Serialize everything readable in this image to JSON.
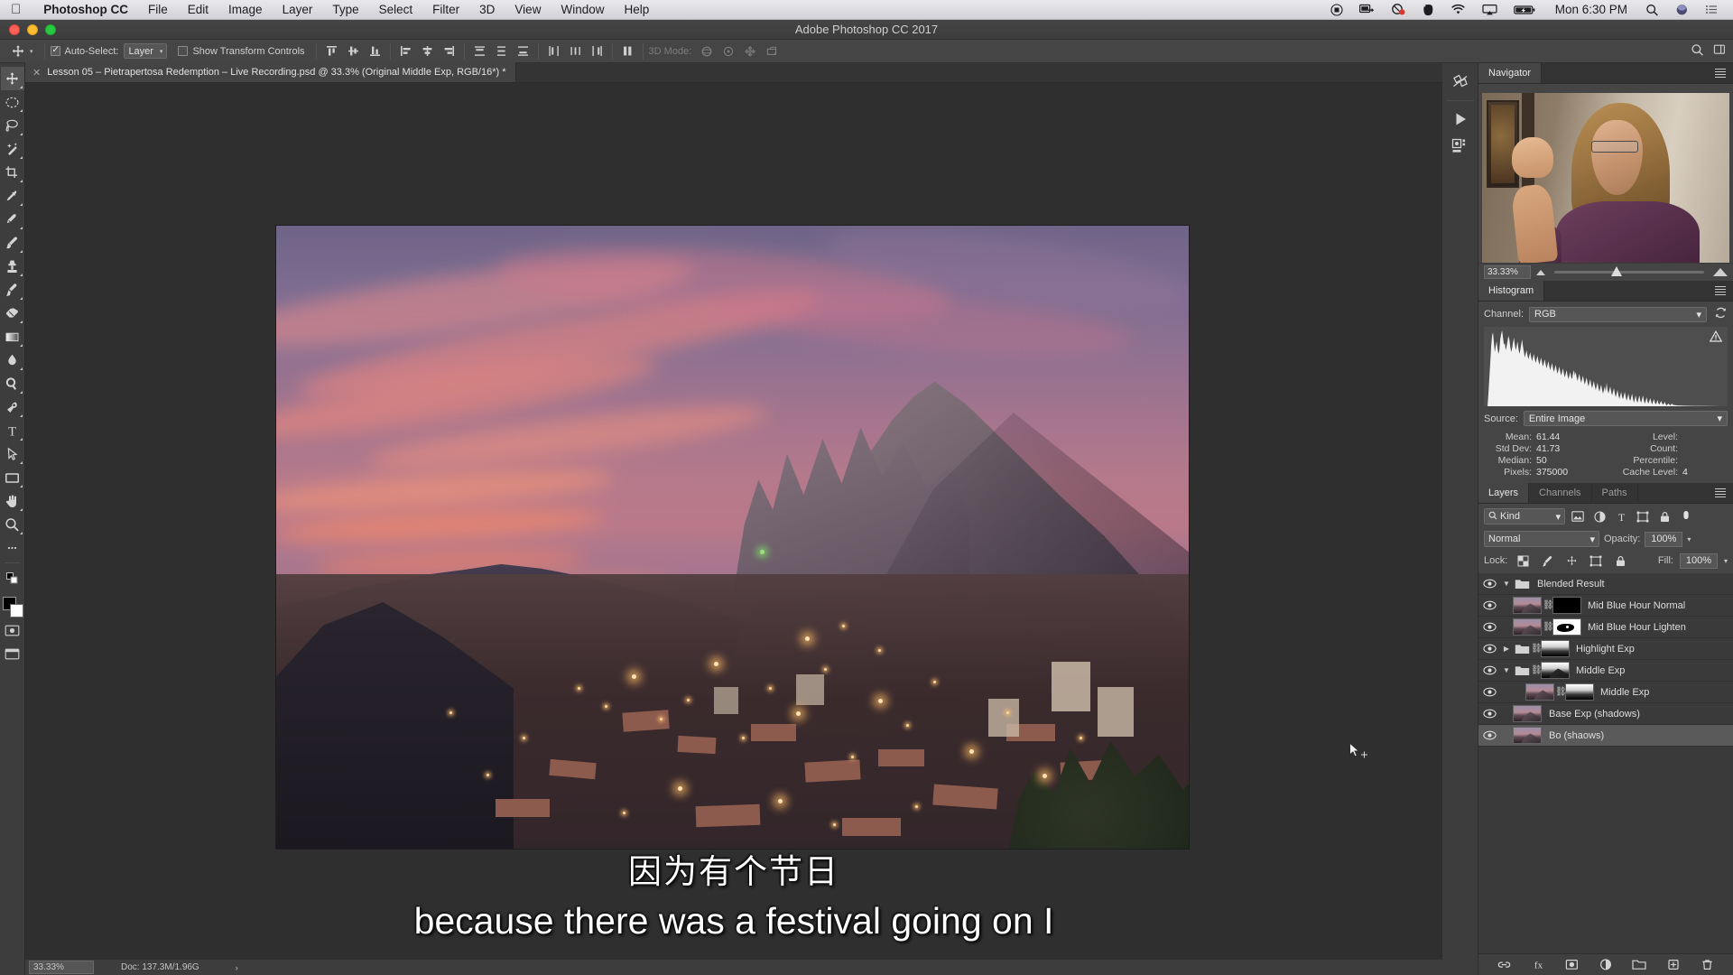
{
  "macbar": {
    "apple_icon": "apple-logo-icon",
    "app_name": "Photoshop CC",
    "menus": [
      "File",
      "Edit",
      "Image",
      "Layer",
      "Type",
      "Select",
      "Filter",
      "3D",
      "View",
      "Window",
      "Help"
    ],
    "status_icons": [
      "record-icon",
      "screen-share-icon",
      "do-not-disturb-icon",
      "evernote-icon",
      "wifi-icon",
      "airplay-icon",
      "battery-charging-icon"
    ],
    "clock": "Mon 6:30 PM",
    "search_icon": "search-icon",
    "siri_icon": "siri-icon",
    "notification_icon": "notification-center-icon"
  },
  "titlebar": {
    "app_title": "Adobe Photoshop CC 2017"
  },
  "options_bar": {
    "tool_icon": "move-tool-icon",
    "auto_select_label": "Auto-Select:",
    "auto_select_checked": true,
    "auto_select_value": "Layer",
    "show_transform_label": "Show Transform Controls",
    "show_transform_checked": false,
    "align_icons": [
      "align-top-edges-icon",
      "align-vertical-centers-icon",
      "align-bottom-edges-icon",
      "align-left-edges-icon",
      "align-horizontal-centers-icon",
      "align-right-edges-icon"
    ],
    "distribute_icons": [
      "distribute-top-edges-icon",
      "distribute-vertical-centers-icon",
      "distribute-bottom-edges-icon",
      "distribute-left-edges-icon",
      "distribute-horizontal-centers-icon",
      "distribute-right-edges-icon"
    ],
    "auto_align_icon": "auto-align-layers-icon",
    "three_d_mode_label": "3D Mode:",
    "three_d_icons": [
      "orbit-3d-icon",
      "roll-3d-icon",
      "pan-3d-icon",
      "slide-3d-icon",
      "scale-3d-icon"
    ],
    "right_icons": [
      "search-icon",
      "workspace-switcher-icon"
    ]
  },
  "document_tab": {
    "close_icon": "close-icon",
    "title": "Lesson 05 – Pietrapertosa Redemption – Live Recording.psd @ 33.3% (Original Middle Exp, RGB/16*) *"
  },
  "toolbar": {
    "tools": [
      {
        "name": "move-tool",
        "active": true
      },
      {
        "name": "elliptical-marquee-tool",
        "active": false
      },
      {
        "name": "lasso-tool",
        "active": false
      },
      {
        "name": "quick-selection-tool",
        "active": false
      },
      {
        "name": "crop-tool",
        "active": false
      },
      {
        "name": "eyedropper-tool",
        "active": false
      },
      {
        "name": "spot-healing-brush-tool",
        "active": false
      },
      {
        "name": "brush-tool",
        "active": false
      },
      {
        "name": "clone-stamp-tool",
        "active": false
      },
      {
        "name": "history-brush-tool",
        "active": false
      },
      {
        "name": "eraser-tool",
        "active": false
      },
      {
        "name": "gradient-tool",
        "active": false
      },
      {
        "name": "blur-tool",
        "active": false
      },
      {
        "name": "dodge-tool",
        "active": false
      },
      {
        "name": "pen-tool",
        "active": false
      },
      {
        "name": "horizontal-type-tool",
        "active": false
      },
      {
        "name": "path-selection-tool",
        "active": false
      },
      {
        "name": "rectangle-tool",
        "active": false
      },
      {
        "name": "hand-tool",
        "active": false
      },
      {
        "name": "zoom-tool",
        "active": false
      }
    ],
    "more_tools_icon": "more-tools-icon",
    "screen_mode_icon": "screen-mode-icon",
    "quick-mask-icon": "quick-mask-icon",
    "foreground_color": "#000000",
    "background_color": "#ffffff"
  },
  "canvas": {
    "image_alt": "Pietrapertosa village at dusk beneath rocky spires"
  },
  "subtitles": {
    "chinese": "因为有个节日",
    "english": "because there was a festival going on I"
  },
  "statusbar": {
    "zoom": "33.33%",
    "doc_info": "Doc: 137.3M/1.96G",
    "chevron": "›"
  },
  "icon_dock": {
    "items": [
      "library-icon",
      "play-icon",
      "properties-icon"
    ]
  },
  "navigator": {
    "tabs": [
      {
        "label": "Navigator",
        "active": true
      }
    ],
    "menu_icon": "panel-menu-icon",
    "zoom_value": "33.33%",
    "zoom_out_icon": "zoom-out-icon",
    "zoom_in_icon": "zoom-in-icon"
  },
  "histogram": {
    "tabs": [
      {
        "label": "Histogram",
        "active": true
      }
    ],
    "menu_icon": "panel-menu-icon",
    "channel_label": "Channel:",
    "channel_value": "RGB",
    "refresh_icon": "refresh-icon",
    "warning_icon": "cached-data-warning-icon",
    "source_label": "Source:",
    "source_value": "Entire Image",
    "stats": [
      {
        "label": "Mean:",
        "value": "61.44",
        "label2": "Level:",
        "value2": ""
      },
      {
        "label": "Std Dev:",
        "value": "41.73",
        "label2": "Count:",
        "value2": ""
      },
      {
        "label": "Median:",
        "value": "50",
        "label2": "Percentile:",
        "value2": ""
      },
      {
        "label": "Pixels:",
        "value": "375000",
        "label2": "Cache Level:",
        "value2": "4"
      }
    ]
  },
  "layers": {
    "tabs": [
      {
        "label": "Layers",
        "active": true
      },
      {
        "label": "Channels",
        "active": false
      },
      {
        "label": "Paths",
        "active": false
      }
    ],
    "menu_icon": "panel-menu-icon",
    "filter_label": "Kind",
    "filter_icon": "search-icon",
    "filter_type_icons": [
      "pixel-layer-filter-icon",
      "adjustment-layer-filter-icon",
      "type-layer-filter-icon",
      "shape-layer-filter-icon",
      "smart-object-filter-icon"
    ],
    "filter_toggle_icon": "filter-toggle-icon",
    "blend_mode": "Normal",
    "opacity_label": "Opacity:",
    "opacity_value": "100%",
    "lock_label": "Lock:",
    "lock_icons": [
      "lock-transparent-pixels-icon",
      "lock-image-pixels-icon",
      "lock-position-icon",
      "lock-artboard-icon",
      "lock-all-icon"
    ],
    "fill_label": "Fill:",
    "fill_value": "100%",
    "rows": [
      {
        "name": "Blended Result",
        "type": "group",
        "expanded": true,
        "visible": true,
        "selected": false,
        "has_thumb": false,
        "has_mask": false,
        "linked": false,
        "indent": 0
      },
      {
        "name": "Mid Blue Hour Normal",
        "type": "layer",
        "visible": true,
        "selected": false,
        "has_thumb": true,
        "has_mask": true,
        "mask_style": "black",
        "linked": true,
        "indent": 1
      },
      {
        "name": "Mid Blue Hour Lighten",
        "type": "layer",
        "visible": true,
        "selected": false,
        "has_thumb": true,
        "has_mask": true,
        "mask_style": "white-blob",
        "linked": true,
        "indent": 1
      },
      {
        "name": "Highlight Exp",
        "type": "group",
        "expanded": false,
        "visible": true,
        "selected": false,
        "has_thumb": false,
        "has_mask": true,
        "mask_style": "gradient",
        "linked": true,
        "indent": 1
      },
      {
        "name": "Middle Exp",
        "type": "group",
        "expanded": true,
        "visible": true,
        "selected": false,
        "has_thumb": false,
        "has_mask": true,
        "mask_style": "gradient",
        "linked": true,
        "indent": 1
      },
      {
        "name": "Middle Exp",
        "type": "layer",
        "visible": true,
        "selected": false,
        "has_thumb": true,
        "has_mask": true,
        "mask_style": "gradient",
        "linked": true,
        "indent": 2
      },
      {
        "name": "Base Exp (shadows)",
        "type": "layer",
        "visible": true,
        "selected": false,
        "has_thumb": true,
        "has_mask": false,
        "linked": false,
        "indent": 1
      },
      {
        "name": "Bo (shaows)",
        "type": "layer",
        "visible": true,
        "selected": true,
        "has_thumb": true,
        "has_mask": false,
        "linked": false,
        "indent": 1
      }
    ],
    "footer_icons": [
      "link-layers-icon",
      "layer-style-icon",
      "add-layer-mask-icon",
      "new-adjustment-layer-icon",
      "new-group-icon",
      "new-layer-icon",
      "delete-layer-icon"
    ]
  },
  "colors": {
    "panel_bg": "#3a3a3a",
    "panel_header": "#454545",
    "canvas_bg": "#2f2f2f",
    "accent_selected": "#5a5a5a"
  }
}
